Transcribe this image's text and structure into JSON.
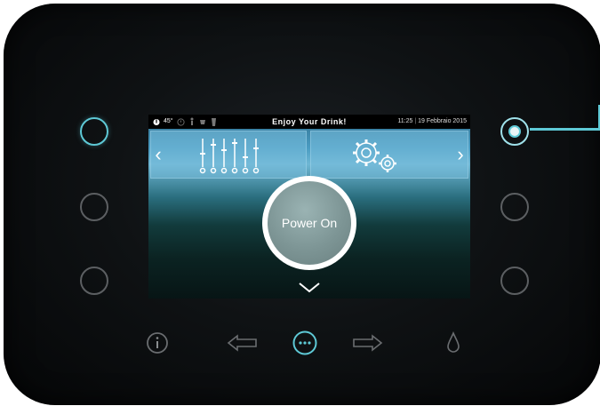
{
  "status": {
    "temperature": "45°",
    "title": "Enjoy Your Drink!",
    "time": "11:25",
    "date": "19 Febbraio 2015"
  },
  "power_button": {
    "label": "Power On"
  },
  "icons": {
    "left_panel": "equalizer-sliders-icon",
    "right_panel": "gears-icon",
    "bottom": [
      "info-icon",
      "arrow-left-icon",
      "more-icon",
      "arrow-right-icon",
      "drop-icon"
    ]
  },
  "colors": {
    "accent": "#5ec9d6",
    "ring_idle": "#5c5f62"
  }
}
